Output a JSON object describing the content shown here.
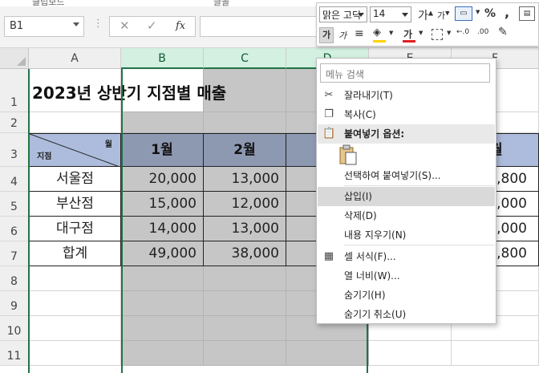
{
  "ribbon": {
    "clipboard_label": "클립보드",
    "font_group_label": "글꼴"
  },
  "formula_bar": {
    "name_box": "B1",
    "cancel_icon": "✕",
    "enter_icon": "✓",
    "fx": "fx",
    "formula": ""
  },
  "columns": [
    "A",
    "B",
    "C",
    "D",
    "E",
    "F"
  ],
  "rows": [
    "1",
    "2",
    "3",
    "4",
    "5",
    "6",
    "7",
    "8",
    "9",
    "10",
    "11"
  ],
  "sheet": {
    "title": "2023년 상반기 지점별 매출",
    "diag_top": "월",
    "diag_bottom": "지점",
    "month_headers": [
      "1월",
      "2월",
      "",
      "",
      "월"
    ],
    "table_rows": [
      {
        "branch": "서울점",
        "b": "20,000",
        "c": "13,000",
        "f": "7,800"
      },
      {
        "branch": "부산점",
        "b": "15,000",
        "c": "12,000",
        "f": "9,000"
      },
      {
        "branch": "대구점",
        "b": "14,000",
        "c": "13,000",
        "f": "5,000"
      },
      {
        "branch": "합계",
        "b": "49,000",
        "c": "38,000",
        "f": "2,800"
      }
    ]
  },
  "mini_toolbar": {
    "font_name": "맑은 고딕",
    "font_size": "14",
    "increase_font": "가",
    "decrease_font": "가",
    "percent": "%",
    "comma": ",",
    "bold": "가",
    "italic": "가",
    "font_color_letter": "가",
    "dec_increase": "←.0",
    "dec_decrease": ".00",
    "accent_red": "#e02020",
    "accent_yellow": "#ffd400"
  },
  "context_menu": {
    "search_placeholder": "메뉴 검색",
    "items": {
      "cut": "잘라내기(T)",
      "copy": "복사(C)",
      "paste_options": "붙여넣기 옵션:",
      "paste_special": "선택하여 붙여넣기(S)...",
      "insert": "삽입(I)",
      "delete": "삭제(D)",
      "clear": "내용 지우기(N)",
      "format_cells": "셀 서식(F)...",
      "col_width": "열 너비(W)...",
      "hide": "숨기기(H)",
      "unhide": "숨기기 취소(U)"
    }
  },
  "colors": {
    "selection_green": "#217346",
    "header_blue": "#adbcdc",
    "selected_gray": "#c6c6c6"
  }
}
